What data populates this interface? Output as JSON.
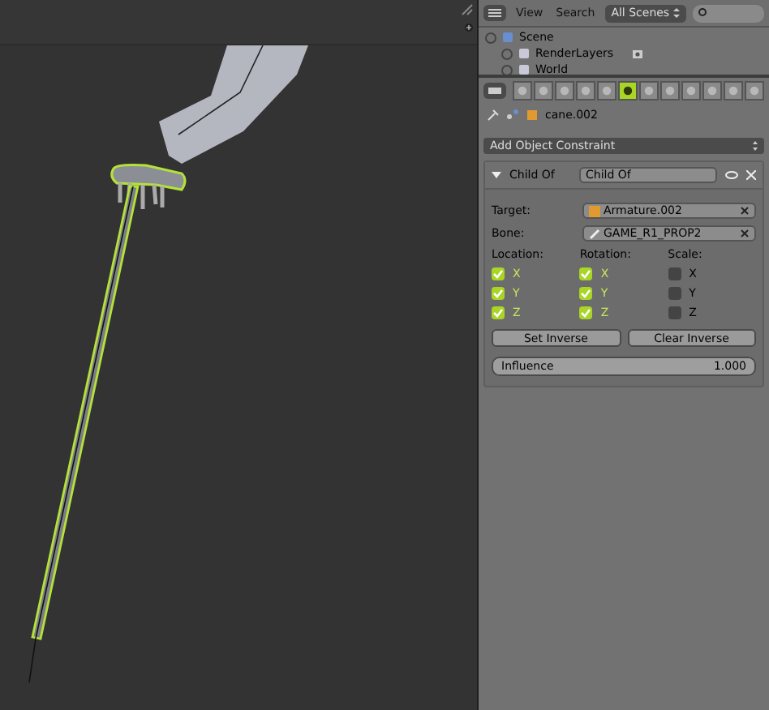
{
  "outliner": {
    "menus": [
      "View",
      "Search"
    ],
    "scene_selector": "All Scenes",
    "tree": [
      {
        "label": "Scene",
        "children": [
          {
            "label": "RenderLayers"
          },
          {
            "label": "World"
          }
        ]
      }
    ]
  },
  "properties": {
    "tabs": [
      {
        "selected": false
      },
      {
        "selected": false
      },
      {
        "selected": false
      },
      {
        "selected": false
      },
      {
        "selected": false
      },
      {
        "selected": true
      },
      {
        "selected": false
      },
      {
        "selected": false
      },
      {
        "selected": false
      },
      {
        "selected": false
      },
      {
        "selected": false
      },
      {
        "selected": false
      }
    ],
    "context": {
      "object": "cane.002"
    },
    "add_constraint": "Add Object Constraint",
    "constraint": {
      "type_label": "Child Of",
      "name": "Child Of",
      "target_label": "Target:",
      "target": "Armature.002",
      "bone_label": "Bone:",
      "bone": "GAME_R1_PROP2",
      "groups": [
        {
          "title": "Location:",
          "axes": [
            {
              "label": "X",
              "checked": true
            },
            {
              "label": "Y",
              "checked": true
            },
            {
              "label": "Z",
              "checked": true
            }
          ]
        },
        {
          "title": "Rotation:",
          "axes": [
            {
              "label": "X",
              "checked": true
            },
            {
              "label": "Y",
              "checked": true
            },
            {
              "label": "Z",
              "checked": true
            }
          ]
        },
        {
          "title": "Scale:",
          "axes": [
            {
              "label": "X",
              "checked": false
            },
            {
              "label": "Y",
              "checked": false
            },
            {
              "label": "Z",
              "checked": false
            }
          ]
        }
      ],
      "buttons": [
        "Set Inverse",
        "Clear Inverse"
      ],
      "influence": {
        "label": "Influence",
        "value": "1.000",
        "level": 1
      }
    }
  }
}
